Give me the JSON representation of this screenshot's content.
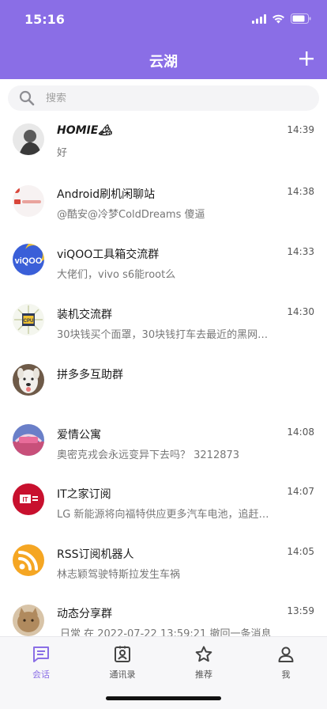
{
  "status_bar": {
    "time": "15:16"
  },
  "header": {
    "title": "云湖",
    "add_icon": "plus-icon",
    "background": "#8a6ee6"
  },
  "search": {
    "placeholder": "搜索",
    "icon": "search-icon"
  },
  "chats": [
    {
      "name": "HOMIE🏔",
      "time": "14:39",
      "message": "好",
      "avatar": "homie-avatar"
    },
    {
      "name": "Android刷机闲聊站",
      "time": "14:38",
      "message": "@酷安@冷梦ColdDreams 傻逼",
      "avatar": "android-avatar"
    },
    {
      "name": "viQOO工具箱交流群",
      "time": "14:33",
      "message": "大佬们，vivo s6能root么",
      "avatar": "viqoo-avatar"
    },
    {
      "name": "装机交流群",
      "time": "14:30",
      "message": "30块钱买个面罩，30块钱打车去最近的黑网…",
      "avatar": "cpu-avatar"
    },
    {
      "name": "拼多多互助群",
      "time": "",
      "message": "",
      "avatar": "dog-avatar"
    },
    {
      "name": "爱情公寓",
      "time": "14:08",
      "message": "奥密克戎会永远变异下去吗？ 3212873",
      "avatar": "apartment-avatar"
    },
    {
      "name": "IT之家订阅",
      "time": "14:07",
      "message": "LG 新能源将向福特供应更多汽车电池，追赶…",
      "avatar": "ithome-avatar"
    },
    {
      "name": "RSS订阅机器人",
      "time": "14:05",
      "message": "林志颖驾驶特斯拉发生车祸",
      "avatar": "rss-avatar"
    },
    {
      "name": "动态分享群",
      "time": "13:59",
      "message": "日常 在 2022-07-22 13:59:21 撤回一条消息",
      "avatar": "cat-avatar"
    }
  ],
  "tabs": [
    {
      "label": "会话",
      "icon": "chat-icon",
      "active": true
    },
    {
      "label": "通讯录",
      "icon": "contacts-icon",
      "active": false
    },
    {
      "label": "推荐",
      "icon": "star-icon",
      "active": false
    },
    {
      "label": "我",
      "icon": "profile-icon",
      "active": false
    }
  ],
  "colors": {
    "accent": "#8a6ee6",
    "rss": "#f5a623",
    "ithome": "#c8102e",
    "viqoo": "#3a5fd8"
  }
}
